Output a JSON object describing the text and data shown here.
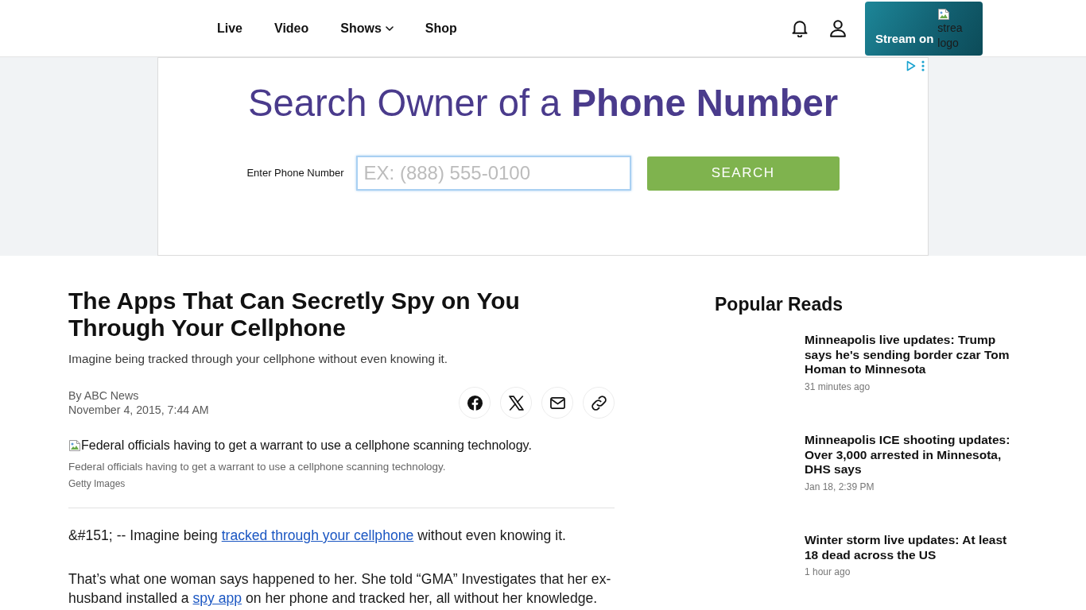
{
  "header": {
    "nav": [
      {
        "label": "Live",
        "kind": "link"
      },
      {
        "label": "Video",
        "kind": "link"
      },
      {
        "label": "Shows",
        "kind": "menu"
      },
      {
        "label": "Shop",
        "kind": "link"
      }
    ],
    "stream_button": {
      "label": "Stream on",
      "logo_alt_lines": [
        "strea",
        "logo"
      ]
    }
  },
  "ad": {
    "headline": "Search Owner of a **Phone Number**",
    "field_label": "Enter Phone Number",
    "phone_field": {
      "placeholder": "EX: (888) 555-0100"
    },
    "search_button": "SEARCH"
  },
  "article": {
    "title": "The Apps That Can Secretly Spy on You Through Your Cellphone",
    "subtitle": "Imagine being tracked through your cellphone without even knowing it.",
    "byline": "By ABC News",
    "date": "November 4, 2015, 7:44 AM",
    "share_buttons": [
      {
        "kind": "facebook"
      },
      {
        "kind": "x"
      },
      {
        "kind": "email"
      },
      {
        "kind": "link"
      }
    ],
    "image": {
      "alt": "Federal officials having to get a warrant to use a cellphone scanning technology.",
      "caption": "Federal officials having to get a warrant to use a cellphone scanning technology.",
      "credit": "Getty Images"
    },
    "paragraphs": [
      [
        {
          "kind": "text",
          "text": "&#151; -- Imagine being "
        },
        {
          "kind": "link",
          "text": "tracked through your cellphone"
        },
        {
          "kind": "text",
          "text": " without even knowing it."
        }
      ],
      [
        {
          "kind": "text",
          "text": "That’s what one woman says happened to her. She told “GMA” Investigates that her ex-husband installed a "
        },
        {
          "kind": "link",
          "text": "spy app"
        },
        {
          "kind": "text",
          "text": " on her phone and tracked her, all without her knowledge."
        }
      ]
    ]
  },
  "popular_reads": {
    "title": "Popular Reads",
    "items": [
      {
        "headline": "Minneapolis live updates: Trump says he's sending border czar Tom Homan to Minnesota",
        "time": "31 minutes ago"
      },
      {
        "headline": "Minneapolis ICE shooting updates: Over 3,000 arrested in Minnesota, DHS says",
        "time": "Jan 18, 2:39 PM"
      },
      {
        "headline": "Winter storm live updates: At least 18 dead across the US",
        "time": "1 hour ago"
      }
    ]
  }
}
